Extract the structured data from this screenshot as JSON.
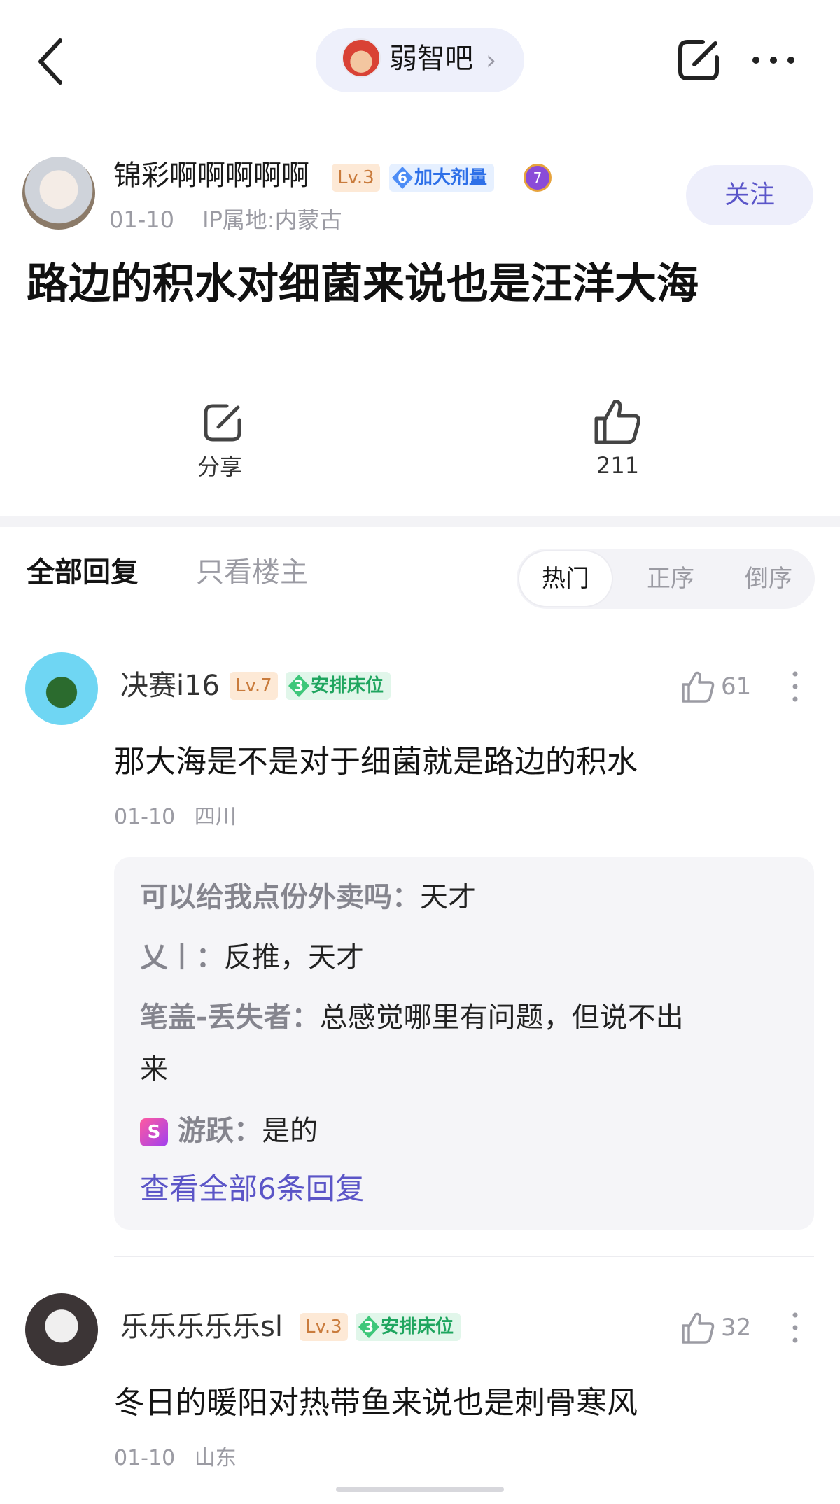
{
  "topbar": {
    "forum_name": "弱智吧",
    "forum_arrow": "›"
  },
  "post": {
    "author": {
      "name": "锦彩啊啊啊啊啊",
      "level": "Lv.3",
      "title_num": "6",
      "title": "加大剂量",
      "medal_num": "7",
      "date": "01-10",
      "ip": "IP属地:内蒙古"
    },
    "follow_label": "关注",
    "title": "路边的积水对细菌来说也是汪洋大海",
    "share_label": "分享",
    "like_count": "211"
  },
  "tabs": {
    "all": "全部回复",
    "op_only": "只看楼主",
    "sort": [
      "热门",
      "正序",
      "倒序"
    ]
  },
  "comments": [
    {
      "user": "决赛i16",
      "level": "Lv.7",
      "title_num": "3",
      "title": "安排床位",
      "likes": "61",
      "text": "那大海是不是对于细菌就是路边的积水",
      "date": "01-10",
      "location": "四川",
      "replies": [
        {
          "who": "可以给我点份外卖吗",
          "text": "天才"
        },
        {
          "who": "乂丨",
          "text": "反推，天才"
        },
        {
          "who": "笔盖-丢失者",
          "text": "总感觉哪里有问题，但说不出",
          "text2": "来"
        },
        {
          "who": "游跃",
          "text": "是的"
        }
      ],
      "view_all": "查看全部6条回复"
    },
    {
      "user": "乐乐乐乐乐sl",
      "level": "Lv.3",
      "title_num": "3",
      "title": "安排床位",
      "likes": "32",
      "text": "冬日的暖阳对热带鱼来说也是刺骨寒风",
      "date": "01-10",
      "location": "山东"
    }
  ],
  "colors": {
    "accent": "#5b55c7",
    "follow_bg": "#eeeffb",
    "reply_bg": "#f5f5f8"
  }
}
